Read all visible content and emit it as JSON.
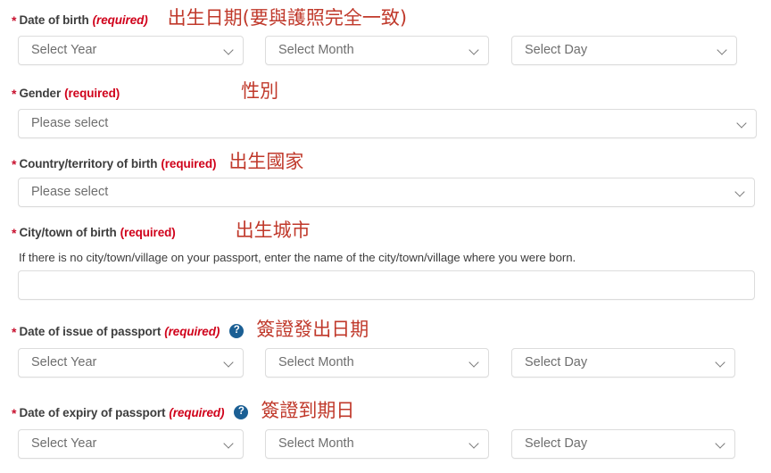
{
  "form": {
    "fields": [
      {
        "id": "date-of-birth",
        "label": "Date of birth",
        "required_text": "(required)",
        "required_italic": true,
        "annotation": "出生日期(要與護照完全一致)",
        "help_icon": false,
        "controls": [
          {
            "type": "select",
            "name": "year",
            "value": "Select Year"
          },
          {
            "type": "select",
            "name": "month",
            "value": "Select Month"
          },
          {
            "type": "select",
            "name": "day",
            "value": "Select Day"
          }
        ]
      },
      {
        "id": "gender",
        "label": "Gender",
        "required_text": "(required)",
        "required_italic": false,
        "annotation": "性別",
        "help_icon": false,
        "controls": [
          {
            "type": "select",
            "name": "gender",
            "value": "Please select"
          }
        ]
      },
      {
        "id": "country-territory-of-birth",
        "label": "Country/territory of birth",
        "required_text": "(required)",
        "required_italic": false,
        "annotation": "出生國家",
        "help_icon": false,
        "controls": [
          {
            "type": "select",
            "name": "country",
            "value": "Please select"
          }
        ]
      },
      {
        "id": "city-town-of-birth",
        "label": "City/town of birth",
        "required_text": "(required)",
        "required_italic": false,
        "annotation": "出生城市",
        "help_icon": false,
        "hint": "If there is no city/town/village on your passport, enter the name of the city/town/village where you were born.",
        "controls": [
          {
            "type": "text",
            "name": "city",
            "value": ""
          }
        ]
      },
      {
        "id": "date-of-issue-of-passport",
        "label": "Date of issue of passport",
        "required_text": "(required)",
        "required_italic": true,
        "annotation": "簽證發出日期",
        "help_icon": true,
        "help_icon_glyph": "?",
        "controls": [
          {
            "type": "select",
            "name": "year",
            "value": "Select Year"
          },
          {
            "type": "select",
            "name": "month",
            "value": "Select Month"
          },
          {
            "type": "select",
            "name": "day",
            "value": "Select Day"
          }
        ]
      },
      {
        "id": "date-of-expiry-of-passport",
        "label": "Date of expiry of passport",
        "required_text": "(required)",
        "required_italic": true,
        "annotation": "簽證到期日",
        "help_icon": true,
        "help_icon_glyph": "?",
        "controls": [
          {
            "type": "select",
            "name": "year",
            "value": "Select Year"
          },
          {
            "type": "select",
            "name": "month",
            "value": "Select Month"
          },
          {
            "type": "select",
            "name": "day",
            "value": "Select Day"
          }
        ]
      }
    ],
    "asterisk": "*"
  },
  "colors": {
    "required_red": "#d0021b",
    "annotation_red": "#c0392b",
    "help_icon_blue": "#1b5f94",
    "label_gray": "#3d3d3d",
    "border_gray": "#dcdcdc",
    "placeholder_gray": "#6e6e6e"
  }
}
